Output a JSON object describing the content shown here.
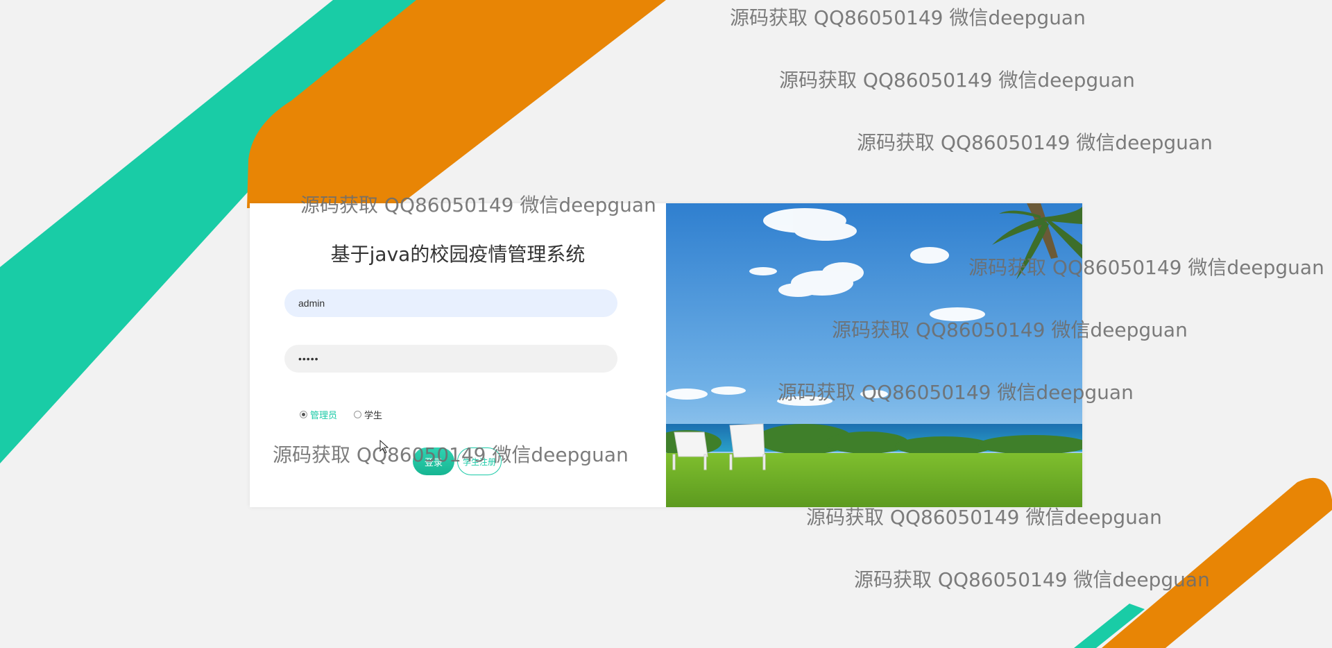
{
  "app": {
    "title": "基于java的校园疫情管理系统"
  },
  "login": {
    "username_value": "admin",
    "password_value": "•••••",
    "roles": [
      {
        "label": "管理员",
        "checked": true
      },
      {
        "label": "学生",
        "checked": false
      }
    ],
    "login_button": "登录",
    "register_button": "学生注册"
  },
  "watermark_text": "源码获取 QQ86050149 微信deepguan",
  "colors": {
    "accent_teal": "#19c9a6",
    "accent_orange": "#e88505",
    "background": "#f2f2f2"
  },
  "icons": [
    "mouse-pointer-icon"
  ]
}
